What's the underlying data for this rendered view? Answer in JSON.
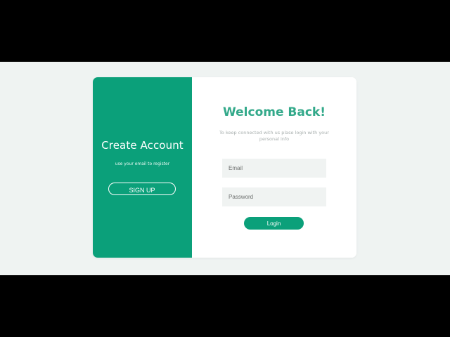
{
  "colors": {
    "accent": "#0ba07a",
    "accent_text": "#33a98a",
    "page_bg": "#eff3f2",
    "field_bg": "#f0f3f2"
  },
  "left_panel": {
    "title": "Create Account",
    "subtitle": "use your email to register",
    "signup_label": "SIGN UP"
  },
  "right_panel": {
    "title": "Welcome Back!",
    "subtitle": "To keep connected with us plase login with your personal info",
    "email_placeholder": "Email",
    "password_placeholder": "Password",
    "login_label": "Login"
  }
}
